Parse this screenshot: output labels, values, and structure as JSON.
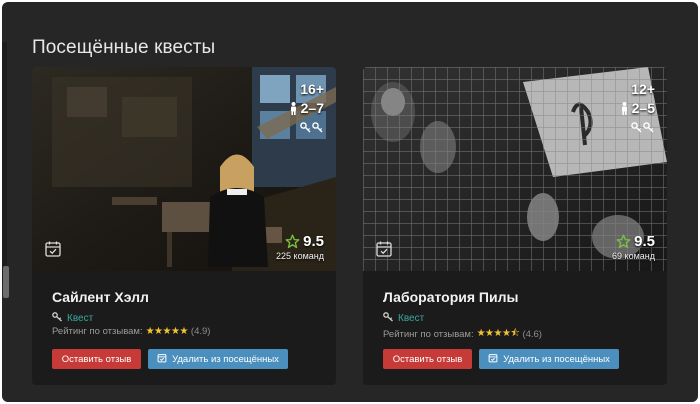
{
  "section": {
    "title": "Посещённые квесты"
  },
  "cards": [
    {
      "title": "Сайлент Хэлл",
      "age": "16+",
      "players": "2–7",
      "rating": "9.5",
      "teams": "225 команд",
      "type": "Квест",
      "reviews_label": "Рейтинг по отзывам:",
      "stars": "★★★★★",
      "reviews_score": "(4.9)",
      "review_button": "Оставить отзыв",
      "remove_button": "Удалить из посещённых"
    },
    {
      "title": "Лаборатория Пилы",
      "age": "12+",
      "players": "2–5",
      "rating": "9.5",
      "teams": "69 команд",
      "type": "Квест",
      "reviews_label": "Рейтинг по отзывам:",
      "stars": "★★★★⯪",
      "reviews_score": "(4.6)",
      "review_button": "Оставить отзыв",
      "remove_button": "Удалить из посещённых"
    }
  ],
  "colors": {
    "background": "#262626",
    "card": "#1b1b1b",
    "accent_teal": "#3aa7a0",
    "rating_green": "#7bc043",
    "star_gold": "#f2c230",
    "button_red": "#c63b38",
    "button_blue": "#4a8fbe"
  },
  "icons": [
    "person-icon",
    "key-icon",
    "calendar-check-icon",
    "star-outline-icon",
    "star-icon"
  ]
}
